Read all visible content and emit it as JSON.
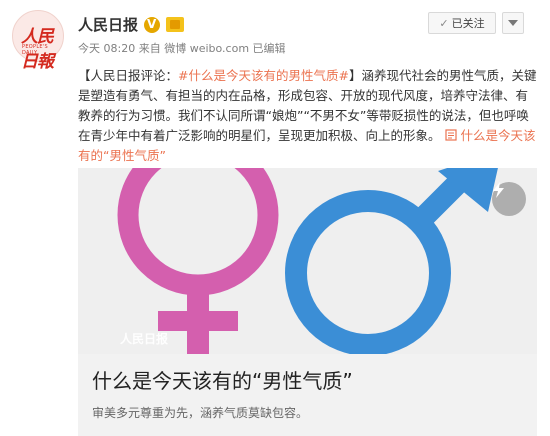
{
  "post": {
    "avatar_text": "人民日報",
    "avatar_subtext": "PEOPLE'S DAILY",
    "name": "人民日报",
    "time": "今天 08:20",
    "source_prefix": "来自",
    "source": "微博 weibo.com",
    "edited": "已编辑",
    "follow_label": "已关注",
    "content": {
      "open_bracket": "【",
      "prefix": "人民日报评论：",
      "hashtag": "#什么是今天该有的男性气质#",
      "close_bracket": "】",
      "body": "涵养现代社会的男性气质，关键是塑造有勇气、有担当的内在品格，形成包容、开放的现代风度，培养守法律、有教养的行为习惯。我们不认同所谓“娘炮”“不男不女”等带贬损性的说法，但也呼唤在青少年中有着广泛影响的明星们，呈现更加积极、向上的形象。",
      "link_text": "什么是今天该有的“男性气质”"
    }
  },
  "card": {
    "watermark": "人民日报",
    "title": "什么是今天该有的“男性气质”",
    "description": "审美多元尊重为先，涵养气质莫缺包容。"
  },
  "colors": {
    "female_symbol": "#d45fae",
    "male_symbol": "#3b8ed6",
    "hashtag": "#eb7350"
  },
  "icons": {
    "verified": "v-verified-icon",
    "badge": "member-badge-icon",
    "check": "check-icon",
    "more": "chevron-down-icon",
    "link": "article-link-icon",
    "share": "lightning-share-icon"
  }
}
